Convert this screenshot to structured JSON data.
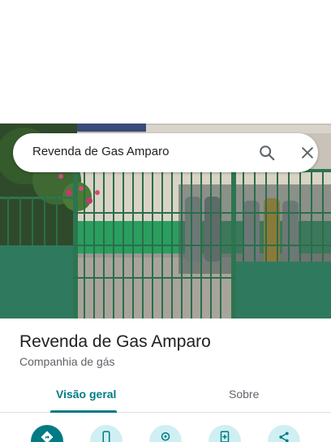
{
  "search": {
    "query": "Revenda de Gas Amparo",
    "search_icon": "search-icon",
    "close_icon": "close-icon"
  },
  "place": {
    "name": "Revenda de Gas Amparo",
    "category": "Companhia de gás"
  },
  "tabs": [
    {
      "label": "Visão geral",
      "selected": true
    },
    {
      "label": "Sobre",
      "selected": false
    }
  ],
  "actions": [
    {
      "icon": "directions-icon"
    },
    {
      "icon": "phone-icon"
    },
    {
      "icon": "location-icon"
    },
    {
      "icon": "save-icon"
    },
    {
      "icon": "share-icon"
    }
  ],
  "colors": {
    "accent": "#007b83",
    "action_bg": "#cfeff3",
    "text_primary": "#202124",
    "text_secondary": "#5f6368"
  }
}
